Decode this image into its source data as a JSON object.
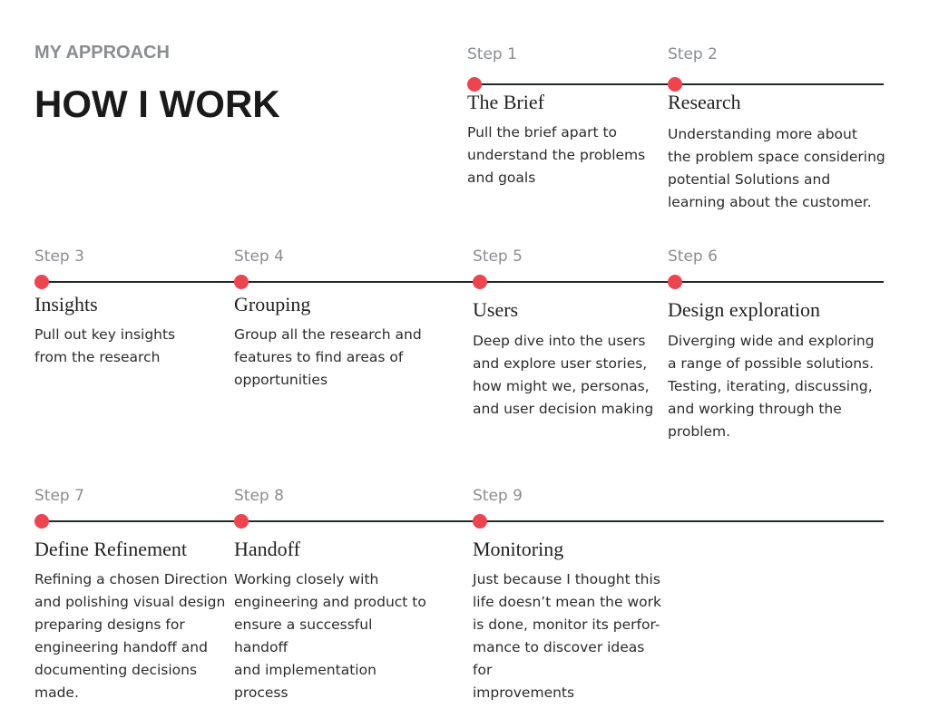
{
  "header": {
    "eyebrow": "MY APPROACH",
    "title": "HOW I WORK"
  },
  "colors": {
    "dot": "#ee4450",
    "line": "#1f2a26",
    "muted": "#8a8d91",
    "text": "#222222"
  },
  "steps": [
    {
      "label": "Step 1",
      "title": "The Brief",
      "description": "Pull the brief apart to\nunderstand the problems\nand goals"
    },
    {
      "label": "Step 2",
      "title": "Research",
      "description": "Understanding more about\nthe problem space considering\npotential Solutions and\nlearning about the customer."
    },
    {
      "label": "Step 3",
      "title": "Insights",
      "description": "Pull out key insights\nfrom the research"
    },
    {
      "label": "Step 4",
      "title": "Grouping",
      "description": "Group all the research and\nfeatures to find areas of\nopportunities"
    },
    {
      "label": "Step 5",
      "title": "Users",
      "description": "Deep dive into the users\nand explore user stories,\nhow might we, personas,\nand user decision making"
    },
    {
      "label": "Step 6",
      "title": "Design exploration",
      "description": "Diverging wide and exploring\na range of possible solutions.\nTesting, iterating, discussing,\nand working through the\nproblem."
    },
    {
      "label": "Step 7",
      "title": "Define Refinement",
      "description": "Refining a chosen Direction\nand polishing visual design\npreparing designs for\nengineering handoff and\ndocumenting decisions\nmade."
    },
    {
      "label": "Step 8",
      "title": "Handoff",
      "description": "Working closely with\nengineering and product to\nensure a successful handoff\nand implementation\nprocess"
    },
    {
      "label": "Step 9",
      "title": "Monitoring",
      "description": "Just because I thought this\nlife doesn’t mean the work\nis done, monitor its perfor-\nmance to discover ideas for\nimprovements"
    }
  ]
}
